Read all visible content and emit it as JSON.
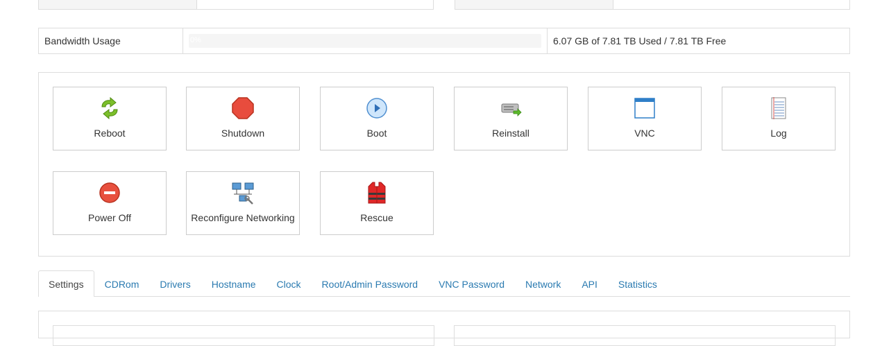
{
  "bandwidth": {
    "label": "Bandwidth Usage",
    "percent_label": "0%",
    "percent_value": 0,
    "usage_text": "6.07 GB of 7.81 TB Used / 7.81 TB Free",
    "bar_color": "#5bc0de"
  },
  "actions": [
    {
      "label": "Reboot",
      "icon": "reboot-icon"
    },
    {
      "label": "Shutdown",
      "icon": "stop-icon"
    },
    {
      "label": "Boot",
      "icon": "play-icon"
    },
    {
      "label": "Reinstall",
      "icon": "reinstall-icon"
    },
    {
      "label": "VNC",
      "icon": "window-icon"
    },
    {
      "label": "Log",
      "icon": "log-icon"
    },
    {
      "label": "Power Off",
      "icon": "power-off-icon"
    },
    {
      "label": "Reconfigure Networking",
      "icon": "network-icon"
    },
    {
      "label": "Rescue",
      "icon": "life-vest-icon"
    }
  ],
  "tabs": [
    {
      "label": "Settings",
      "active": true
    },
    {
      "label": "CDRom",
      "active": false
    },
    {
      "label": "Drivers",
      "active": false
    },
    {
      "label": "Hostname",
      "active": false
    },
    {
      "label": "Clock",
      "active": false
    },
    {
      "label": "Root/Admin Password",
      "active": false
    },
    {
      "label": "VNC Password",
      "active": false
    },
    {
      "label": "Network",
      "active": false
    },
    {
      "label": "API",
      "active": false
    },
    {
      "label": "Statistics",
      "active": false
    }
  ],
  "colors": {
    "link": "#2a7ab0",
    "border": "#dddddd"
  }
}
